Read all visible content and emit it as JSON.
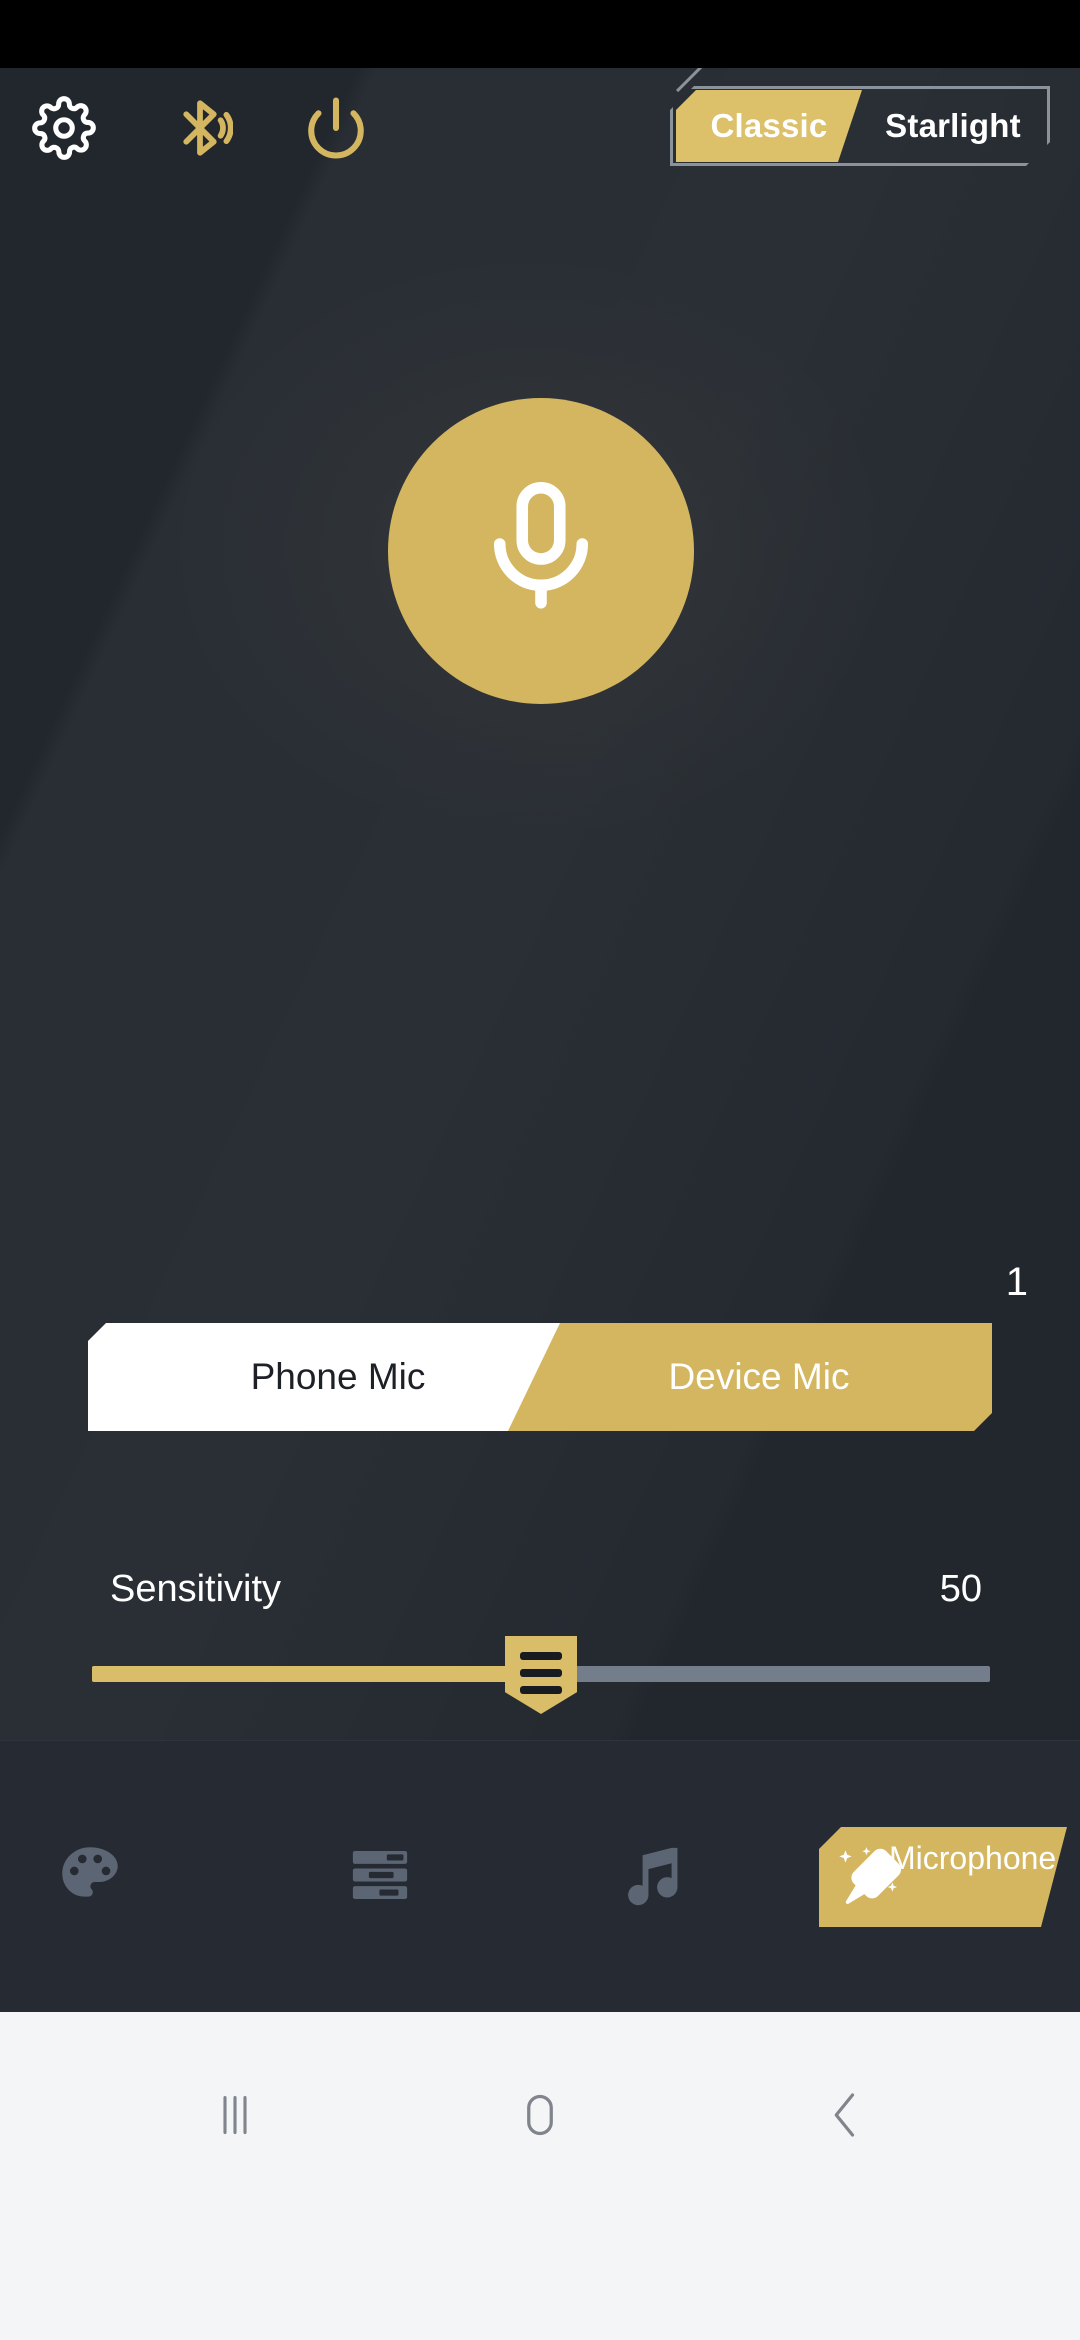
{
  "app": {
    "background_color": "#22272e",
    "accent_color": "#d3b65f",
    "panel_color": "#262b33"
  },
  "top_bar": {
    "settings_icon": "gear-icon",
    "bluetooth_icon": "bluetooth-icon",
    "power_icon": "power-icon",
    "theme_toggle": {
      "options": [
        {
          "label": "Classic",
          "selected": true
        },
        {
          "label": "Starlight",
          "selected": false
        }
      ],
      "selected_label": "Classic",
      "unselected_label": "Starlight",
      "active_color": "#dcc06a"
    }
  },
  "main": {
    "mic_button": {
      "icon": "microphone-icon",
      "state": "active",
      "color": "#d3b65f"
    },
    "source_count": "1",
    "mic_source_toggle": {
      "options": [
        {
          "label": "Phone Mic",
          "selected": true
        },
        {
          "label": "Device Mic",
          "selected": false
        }
      ],
      "phone_label": "Phone Mic",
      "device_label": "Device Mic"
    },
    "sensitivity": {
      "label": "Sensitivity",
      "value": "50",
      "percent": 50,
      "min": 0,
      "max": 100,
      "fill_color": "#d9bd69",
      "track_color": "#737d8c"
    }
  },
  "bottom_nav": {
    "items": [
      {
        "label": "",
        "icon": "palette-icon",
        "selected": false
      },
      {
        "label": "",
        "icon": "equalizer-icon",
        "selected": false
      },
      {
        "label": "",
        "icon": "music-note-icon",
        "selected": false
      },
      {
        "label": "Microphone",
        "icon": "microphone-sparkle-icon",
        "selected": true
      }
    ],
    "microphone_label": "Microphone"
  },
  "system_nav": {
    "recents_icon": "recents-icon",
    "home_icon": "home-icon",
    "back_icon": "back-icon"
  }
}
